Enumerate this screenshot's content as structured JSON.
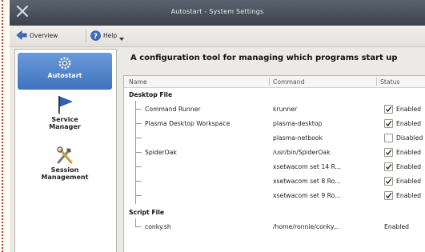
{
  "window": {
    "title": "Autostart - System Settings"
  },
  "toolbar": {
    "overview_label": "Overview",
    "help_label": "Help"
  },
  "sidebar": {
    "items": [
      {
        "label_line1": "Autostart",
        "label_line2": "",
        "icon": "gear-icon",
        "active": true
      },
      {
        "label_line1": "Service",
        "label_line2": "Manager",
        "icon": "flag-icon",
        "active": false
      },
      {
        "label_line1": "Session",
        "label_line2": "Management",
        "icon": "tools-icon",
        "active": false
      }
    ]
  },
  "main": {
    "description": "A configuration tool for managing which programs start up",
    "columns": {
      "name": "Name",
      "command": "Command",
      "status": "Status"
    },
    "groups": {
      "desktop": "Desktop File",
      "script": "Script File"
    },
    "rows": [
      {
        "name": "Command Runner",
        "command": "krunner",
        "checked": true,
        "status": "Enabled"
      },
      {
        "name": "Plasma Desktop Workspace",
        "command": "plasma-desktop",
        "checked": true,
        "status": "Enabled"
      },
      {
        "name": "",
        "command": "plasma-netbook",
        "checked": false,
        "status": "Disabled"
      },
      {
        "name": "SpiderOak",
        "command": "/usr/bin/SpiderOak",
        "checked": true,
        "status": "Enabled"
      },
      {
        "name": "",
        "command": "xsetwacom set 14 R...",
        "checked": true,
        "status": "Enabled"
      },
      {
        "name": "",
        "command": "xsetwacom set 8 Ro...",
        "checked": true,
        "status": "Enabled"
      },
      {
        "name": "",
        "command": "xsetwacom set 9 Ro...",
        "checked": true,
        "status": "Enabled"
      }
    ],
    "script_row": {
      "name": "conky.sh",
      "command": "/home/ronnie/conky...",
      "status": "Enabled"
    }
  },
  "colors": {
    "accent": "#3f73bf",
    "titlebar": "#4a535d"
  }
}
